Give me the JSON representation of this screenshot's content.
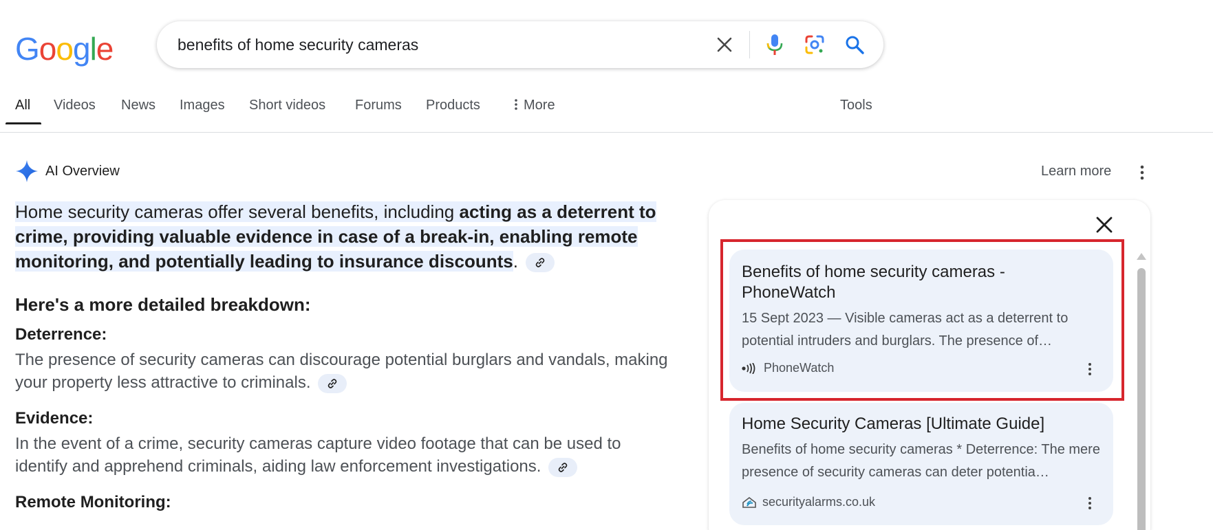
{
  "logo": {
    "letters": [
      "G",
      "o",
      "o",
      "g",
      "l",
      "e"
    ],
    "colors": [
      "#4285f4",
      "#ea4335",
      "#fbbc05",
      "#4285f4",
      "#34a853",
      "#ea4335"
    ]
  },
  "search": {
    "query": "benefits of home security cameras",
    "icons": [
      "close-icon",
      "mic-icon",
      "lens-icon",
      "search-icon"
    ]
  },
  "tabs": [
    {
      "label": "All",
      "active": true
    },
    {
      "label": "Videos"
    },
    {
      "label": "News"
    },
    {
      "label": "Images"
    },
    {
      "label": "Short videos"
    },
    {
      "label": "Forums"
    },
    {
      "label": "Products"
    },
    {
      "label": "More"
    },
    {
      "label": "Tools"
    }
  ],
  "ai_overview": {
    "title": "AI Overview",
    "learn_more": "Learn more",
    "intro_plain": "Home security cameras offer several benefits, including ",
    "intro_bold": "acting as a deterrent to crime, providing valuable evidence in case of a break-in, enabling remote monitoring, and potentially leading to insurance discounts",
    "intro_end": ".",
    "breakdown_title": "Here's a more detailed breakdown:",
    "sections": [
      {
        "title": "Deterrence:",
        "body": "The presence of security cameras can discourage potential burglars and vandals, making your property less attractive to criminals."
      },
      {
        "title": "Evidence:",
        "body": "In the event of a crime, security cameras capture video footage that can be used to identify and apprehend criminals, aiding law enforcement investigations."
      },
      {
        "title": "Remote Monitoring:",
        "body": ""
      }
    ]
  },
  "panel": {
    "cards": [
      {
        "title": "Benefits of home security cameras - PhoneWatch",
        "snippet": "15 Sept 2023 — Visible cameras act as a deterrent to potential intruders and burglars. The presence of…",
        "source": "PhoneWatch"
      },
      {
        "title": "Home Security Cameras [Ultimate Guide]",
        "snippet": "Benefits of home security cameras * Deterrence: The mere presence of security cameras can deter potentia…",
        "source": "securityalarms.co.uk"
      }
    ]
  },
  "colors": {
    "accent_highlight": "#d7262d",
    "blue": "#1a73e8",
    "chip_bg": "#e8eef9",
    "card_bg": "#edf2fa"
  }
}
